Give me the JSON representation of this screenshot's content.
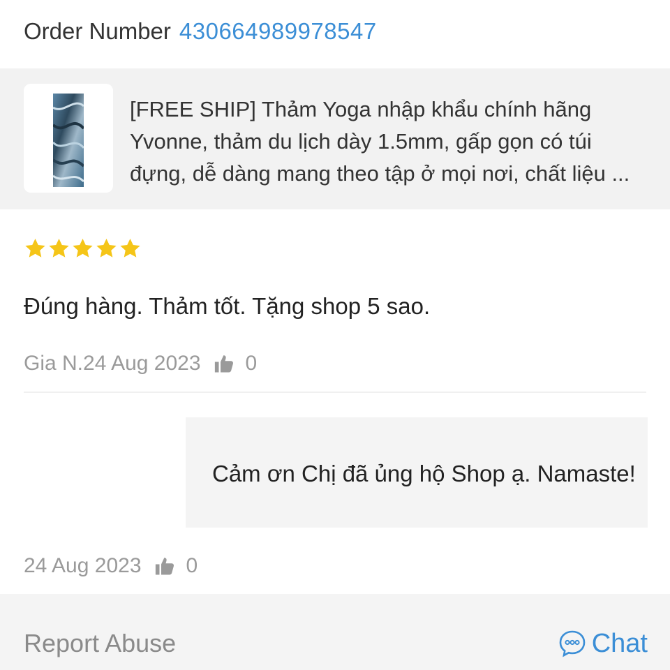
{
  "order": {
    "label": "Order Number",
    "number": "430664989978547"
  },
  "product": {
    "title": "[FREE SHIP] Thảm Yoga nhập khẩu chính hãng Yvonne, thảm du lịch dày 1.5mm, gấp gọn có túi đựng, dễ dàng mang theo tập ở mọi nơi, chất liệu ...",
    "thumbnail_icon": "yoga-mat-image"
  },
  "review": {
    "rating": 5,
    "rating_max": 5,
    "text": "Đúng hàng. Thảm tốt. Tặng shop 5 sao.",
    "author_date": "Gia N.24 Aug 2023",
    "likes": "0"
  },
  "reply": {
    "text": "Cảm ơn Chị đã ủng hộ Shop ạ. Namaste!",
    "date": "24 Aug 2023",
    "likes": "0"
  },
  "footer": {
    "report_label": "Report Abuse",
    "chat_label": "Chat"
  },
  "colors": {
    "link_blue": "#3b8ed6",
    "star_gold": "#f5c518",
    "meta_gray": "#9a9a9a",
    "card_bg": "#f2f2f2"
  }
}
